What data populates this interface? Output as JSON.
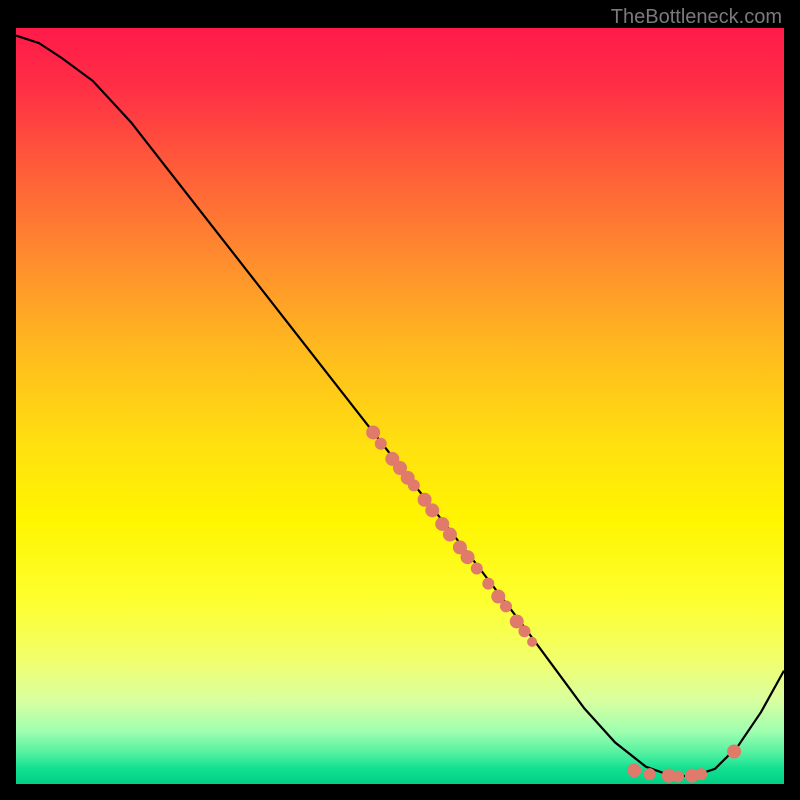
{
  "watermark": "TheBottleneck.com",
  "chart_data": {
    "type": "line",
    "title": "",
    "xlabel": "",
    "ylabel": "",
    "xlim": [
      0,
      100
    ],
    "ylim": [
      0,
      100
    ],
    "grid": false,
    "curve": {
      "x": [
        0,
        3,
        6,
        10,
        15,
        20,
        25,
        30,
        35,
        40,
        45,
        50,
        55,
        60,
        63,
        66,
        70,
        74,
        78,
        82,
        85,
        88,
        91,
        94,
        97,
        100
      ],
      "y": [
        99,
        98,
        96,
        93,
        87.5,
        81,
        74.5,
        68,
        61.5,
        55,
        48.5,
        42,
        35.5,
        29,
        25,
        21,
        15.5,
        10,
        5.5,
        2.3,
        1.2,
        1.0,
        2.0,
        5.0,
        9.5,
        15
      ]
    },
    "scatter_clusters": [
      {
        "x": 46.5,
        "y": 46.5,
        "r": 7
      },
      {
        "x": 47.5,
        "y": 45.0,
        "r": 6
      },
      {
        "x": 49.0,
        "y": 43.0,
        "r": 7
      },
      {
        "x": 50.0,
        "y": 41.8,
        "r": 7
      },
      {
        "x": 51.0,
        "y": 40.5,
        "r": 7
      },
      {
        "x": 51.8,
        "y": 39.5,
        "r": 6
      },
      {
        "x": 53.2,
        "y": 37.6,
        "r": 7
      },
      {
        "x": 54.2,
        "y": 36.2,
        "r": 7
      },
      {
        "x": 55.5,
        "y": 34.4,
        "r": 7
      },
      {
        "x": 56.5,
        "y": 33.0,
        "r": 7
      },
      {
        "x": 57.8,
        "y": 31.3,
        "r": 7
      },
      {
        "x": 58.8,
        "y": 30.0,
        "r": 7
      },
      {
        "x": 60.0,
        "y": 28.5,
        "r": 6
      },
      {
        "x": 61.5,
        "y": 26.5,
        "r": 6
      },
      {
        "x": 62.8,
        "y": 24.8,
        "r": 7
      },
      {
        "x": 63.8,
        "y": 23.5,
        "r": 6
      },
      {
        "x": 65.2,
        "y": 21.5,
        "r": 7
      },
      {
        "x": 66.2,
        "y": 20.2,
        "r": 6
      },
      {
        "x": 67.2,
        "y": 18.8,
        "r": 5
      },
      {
        "x": 80.5,
        "y": 1.8,
        "r": 7
      },
      {
        "x": 82.5,
        "y": 1.3,
        "r": 6
      },
      {
        "x": 85.0,
        "y": 1.1,
        "r": 7
      },
      {
        "x": 86.2,
        "y": 1.0,
        "r": 6
      },
      {
        "x": 88.0,
        "y": 1.1,
        "r": 7
      },
      {
        "x": 89.2,
        "y": 1.3,
        "r": 6
      },
      {
        "x": 93.5,
        "y": 4.3,
        "r": 7
      }
    ]
  }
}
